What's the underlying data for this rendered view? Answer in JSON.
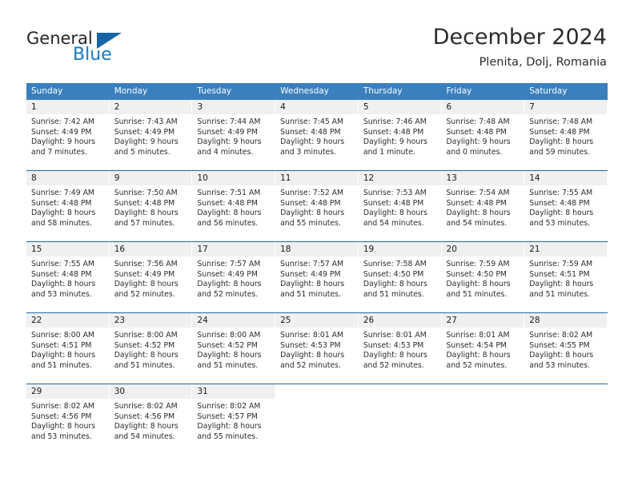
{
  "brand": {
    "name_part1": "General",
    "name_part2": "Blue",
    "triangle_color": "#1565a8",
    "blue_color": "#1779c4"
  },
  "header": {
    "title": "December 2024",
    "location": "Plenita, Dolj, Romania",
    "header_bg": "#3a7fbe",
    "row_divider_color": "#1f6aab",
    "day_band_bg": "#f0f0f0"
  },
  "weekdays": [
    "Sunday",
    "Monday",
    "Tuesday",
    "Wednesday",
    "Thursday",
    "Friday",
    "Saturday"
  ],
  "weeks": [
    [
      {
        "day": "1",
        "sunrise": "Sunrise: 7:42 AM",
        "sunset": "Sunset: 4:49 PM",
        "daylight1": "Daylight: 9 hours",
        "daylight2": "and 7 minutes."
      },
      {
        "day": "2",
        "sunrise": "Sunrise: 7:43 AM",
        "sunset": "Sunset: 4:49 PM",
        "daylight1": "Daylight: 9 hours",
        "daylight2": "and 5 minutes."
      },
      {
        "day": "3",
        "sunrise": "Sunrise: 7:44 AM",
        "sunset": "Sunset: 4:49 PM",
        "daylight1": "Daylight: 9 hours",
        "daylight2": "and 4 minutes."
      },
      {
        "day": "4",
        "sunrise": "Sunrise: 7:45 AM",
        "sunset": "Sunset: 4:48 PM",
        "daylight1": "Daylight: 9 hours",
        "daylight2": "and 3 minutes."
      },
      {
        "day": "5",
        "sunrise": "Sunrise: 7:46 AM",
        "sunset": "Sunset: 4:48 PM",
        "daylight1": "Daylight: 9 hours",
        "daylight2": "and 1 minute."
      },
      {
        "day": "6",
        "sunrise": "Sunrise: 7:48 AM",
        "sunset": "Sunset: 4:48 PM",
        "daylight1": "Daylight: 9 hours",
        "daylight2": "and 0 minutes."
      },
      {
        "day": "7",
        "sunrise": "Sunrise: 7:48 AM",
        "sunset": "Sunset: 4:48 PM",
        "daylight1": "Daylight: 8 hours",
        "daylight2": "and 59 minutes."
      }
    ],
    [
      {
        "day": "8",
        "sunrise": "Sunrise: 7:49 AM",
        "sunset": "Sunset: 4:48 PM",
        "daylight1": "Daylight: 8 hours",
        "daylight2": "and 58 minutes."
      },
      {
        "day": "9",
        "sunrise": "Sunrise: 7:50 AM",
        "sunset": "Sunset: 4:48 PM",
        "daylight1": "Daylight: 8 hours",
        "daylight2": "and 57 minutes."
      },
      {
        "day": "10",
        "sunrise": "Sunrise: 7:51 AM",
        "sunset": "Sunset: 4:48 PM",
        "daylight1": "Daylight: 8 hours",
        "daylight2": "and 56 minutes."
      },
      {
        "day": "11",
        "sunrise": "Sunrise: 7:52 AM",
        "sunset": "Sunset: 4:48 PM",
        "daylight1": "Daylight: 8 hours",
        "daylight2": "and 55 minutes."
      },
      {
        "day": "12",
        "sunrise": "Sunrise: 7:53 AM",
        "sunset": "Sunset: 4:48 PM",
        "daylight1": "Daylight: 8 hours",
        "daylight2": "and 54 minutes."
      },
      {
        "day": "13",
        "sunrise": "Sunrise: 7:54 AM",
        "sunset": "Sunset: 4:48 PM",
        "daylight1": "Daylight: 8 hours",
        "daylight2": "and 54 minutes."
      },
      {
        "day": "14",
        "sunrise": "Sunrise: 7:55 AM",
        "sunset": "Sunset: 4:48 PM",
        "daylight1": "Daylight: 8 hours",
        "daylight2": "and 53 minutes."
      }
    ],
    [
      {
        "day": "15",
        "sunrise": "Sunrise: 7:55 AM",
        "sunset": "Sunset: 4:48 PM",
        "daylight1": "Daylight: 8 hours",
        "daylight2": "and 53 minutes."
      },
      {
        "day": "16",
        "sunrise": "Sunrise: 7:56 AM",
        "sunset": "Sunset: 4:49 PM",
        "daylight1": "Daylight: 8 hours",
        "daylight2": "and 52 minutes."
      },
      {
        "day": "17",
        "sunrise": "Sunrise: 7:57 AM",
        "sunset": "Sunset: 4:49 PM",
        "daylight1": "Daylight: 8 hours",
        "daylight2": "and 52 minutes."
      },
      {
        "day": "18",
        "sunrise": "Sunrise: 7:57 AM",
        "sunset": "Sunset: 4:49 PM",
        "daylight1": "Daylight: 8 hours",
        "daylight2": "and 51 minutes."
      },
      {
        "day": "19",
        "sunrise": "Sunrise: 7:58 AM",
        "sunset": "Sunset: 4:50 PM",
        "daylight1": "Daylight: 8 hours",
        "daylight2": "and 51 minutes."
      },
      {
        "day": "20",
        "sunrise": "Sunrise: 7:59 AM",
        "sunset": "Sunset: 4:50 PM",
        "daylight1": "Daylight: 8 hours",
        "daylight2": "and 51 minutes."
      },
      {
        "day": "21",
        "sunrise": "Sunrise: 7:59 AM",
        "sunset": "Sunset: 4:51 PM",
        "daylight1": "Daylight: 8 hours",
        "daylight2": "and 51 minutes."
      }
    ],
    [
      {
        "day": "22",
        "sunrise": "Sunrise: 8:00 AM",
        "sunset": "Sunset: 4:51 PM",
        "daylight1": "Daylight: 8 hours",
        "daylight2": "and 51 minutes."
      },
      {
        "day": "23",
        "sunrise": "Sunrise: 8:00 AM",
        "sunset": "Sunset: 4:52 PM",
        "daylight1": "Daylight: 8 hours",
        "daylight2": "and 51 minutes."
      },
      {
        "day": "24",
        "sunrise": "Sunrise: 8:00 AM",
        "sunset": "Sunset: 4:52 PM",
        "daylight1": "Daylight: 8 hours",
        "daylight2": "and 51 minutes."
      },
      {
        "day": "25",
        "sunrise": "Sunrise: 8:01 AM",
        "sunset": "Sunset: 4:53 PM",
        "daylight1": "Daylight: 8 hours",
        "daylight2": "and 52 minutes."
      },
      {
        "day": "26",
        "sunrise": "Sunrise: 8:01 AM",
        "sunset": "Sunset: 4:53 PM",
        "daylight1": "Daylight: 8 hours",
        "daylight2": "and 52 minutes."
      },
      {
        "day": "27",
        "sunrise": "Sunrise: 8:01 AM",
        "sunset": "Sunset: 4:54 PM",
        "daylight1": "Daylight: 8 hours",
        "daylight2": "and 52 minutes."
      },
      {
        "day": "28",
        "sunrise": "Sunrise: 8:02 AM",
        "sunset": "Sunset: 4:55 PM",
        "daylight1": "Daylight: 8 hours",
        "daylight2": "and 53 minutes."
      }
    ],
    [
      {
        "day": "29",
        "sunrise": "Sunrise: 8:02 AM",
        "sunset": "Sunset: 4:56 PM",
        "daylight1": "Daylight: 8 hours",
        "daylight2": "and 53 minutes."
      },
      {
        "day": "30",
        "sunrise": "Sunrise: 8:02 AM",
        "sunset": "Sunset: 4:56 PM",
        "daylight1": "Daylight: 8 hours",
        "daylight2": "and 54 minutes."
      },
      {
        "day": "31",
        "sunrise": "Sunrise: 8:02 AM",
        "sunset": "Sunset: 4:57 PM",
        "daylight1": "Daylight: 8 hours",
        "daylight2": "and 55 minutes."
      },
      {
        "day": "",
        "sunrise": "",
        "sunset": "",
        "daylight1": "",
        "daylight2": ""
      },
      {
        "day": "",
        "sunrise": "",
        "sunset": "",
        "daylight1": "",
        "daylight2": ""
      },
      {
        "day": "",
        "sunrise": "",
        "sunset": "",
        "daylight1": "",
        "daylight2": ""
      },
      {
        "day": "",
        "sunrise": "",
        "sunset": "",
        "daylight1": "",
        "daylight2": ""
      }
    ]
  ]
}
